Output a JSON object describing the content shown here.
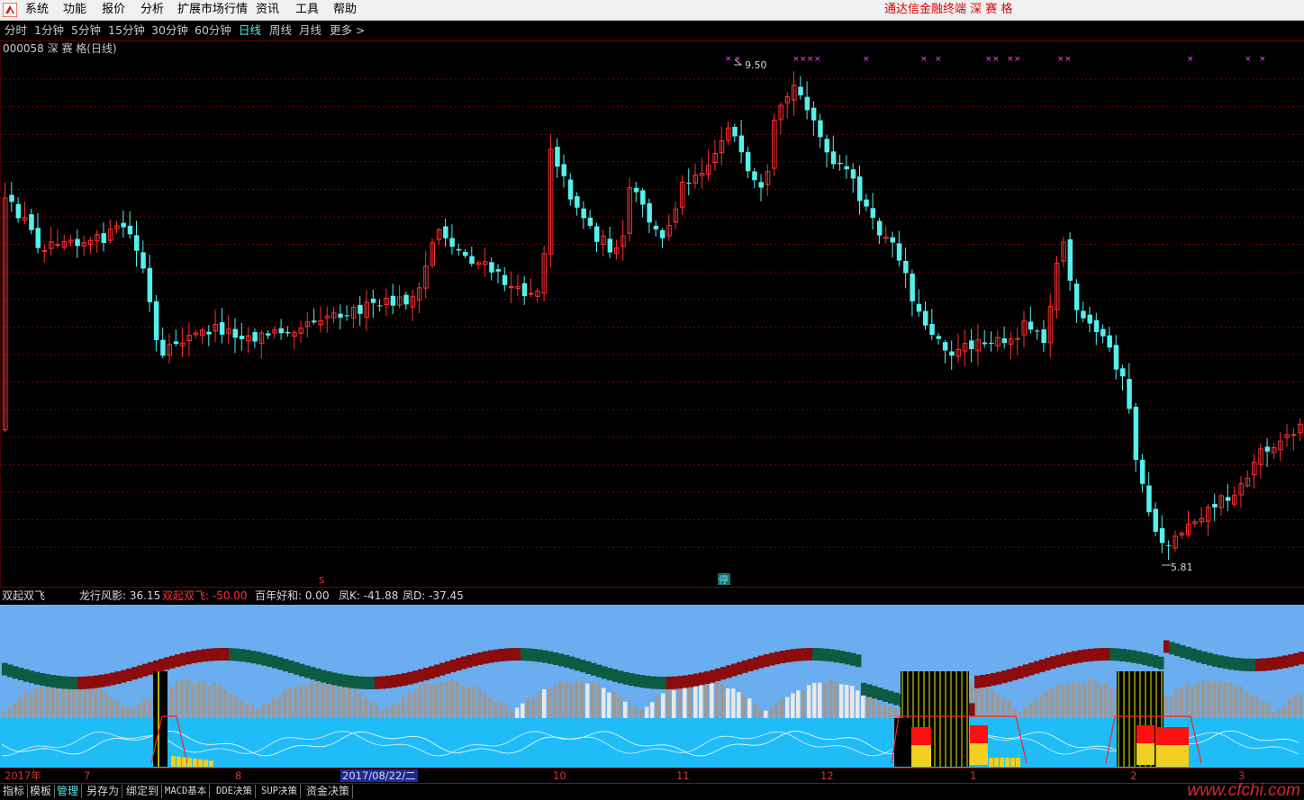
{
  "menubar": {
    "items": [
      "系统",
      "功能",
      "报价",
      "分析",
      "扩展市场行情",
      "资讯",
      "工具",
      "帮助"
    ],
    "app_title": "通达信金融终端   深 赛 格"
  },
  "periods": {
    "items": [
      "分时",
      "1分钟",
      "5分钟",
      "15分钟",
      "30分钟",
      "60分钟",
      "日线",
      "周线",
      "月线",
      "更多 >"
    ],
    "active": "日线"
  },
  "stock": {
    "label": "000058 深 赛 格(日线)"
  },
  "main_chart": {
    "high_label": "9.50",
    "low_label": "5.81",
    "marker_s": "S",
    "marker_halt": "停",
    "colors": {
      "up": "#ff3030",
      "down": "#54f0ee",
      "grid": "#7a0000",
      "marker": "#ff44ff"
    }
  },
  "indicator": {
    "name": "双起双飞",
    "values": [
      {
        "label": "龙行风影: 36.15",
        "color": "#d8d8d8"
      },
      {
        "label": "双起双飞: -50.00",
        "color": "#ff3030"
      },
      {
        "label": "百年好和: 0.00",
        "color": "#d8d8d8"
      },
      {
        "label": "凤K: -41.88",
        "color": "#d8d8d8"
      },
      {
        "label": "凤D: -37.45",
        "color": "#d8d8d8"
      }
    ]
  },
  "datebar": {
    "labels": [
      "2017年",
      "7",
      "8",
      "10",
      "11",
      "12",
      "1",
      "2",
      "3"
    ],
    "cursor": "2017/08/22/二"
  },
  "tabs": [
    "指标",
    "模板",
    "管理",
    "另存为",
    "绑定到",
    "MACD基本",
    "DDE决策",
    "SUP决策",
    "资金决策"
  ],
  "tab_active": "管理",
  "watermark": "www.cfchi.com"
}
